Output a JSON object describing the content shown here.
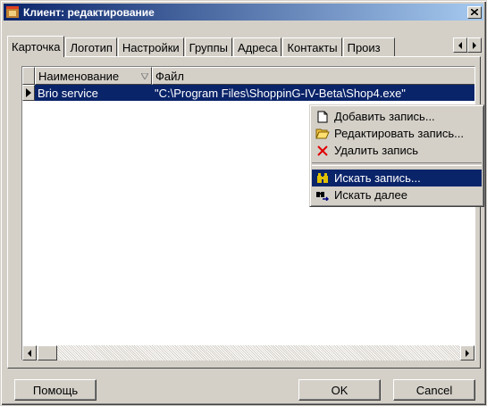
{
  "window": {
    "title": "Клиент: редактирование"
  },
  "tabs": [
    "Карточка",
    "Логотип",
    "Настройки",
    "Группы",
    "Адреса",
    "Контакты",
    "Произ"
  ],
  "grid": {
    "columns": [
      "Наименование",
      "Файл"
    ],
    "rows": [
      {
        "name": "Brio service",
        "file": "\"C:\\Program Files\\ShoppinG-IV-Beta\\Shop4.exe\""
      }
    ]
  },
  "context_menu": {
    "items": [
      {
        "label": "Добавить запись...",
        "icon": "page-icon"
      },
      {
        "label": "Редактировать запись...",
        "icon": "open-folder-icon"
      },
      {
        "label": "Удалить запись",
        "icon": "delete-x-icon"
      },
      {
        "label": "Искать запись...",
        "icon": "binoculars-icon"
      },
      {
        "label": "Искать далее",
        "icon": "binoculars-next-icon"
      }
    ]
  },
  "buttons": {
    "help": "Помощь",
    "ok": "OK",
    "cancel": "Cancel"
  },
  "colors": {
    "title_start": "#0a246a",
    "title_end": "#a6caf0",
    "selection": "#0a246a",
    "face": "#d4d0c8"
  }
}
